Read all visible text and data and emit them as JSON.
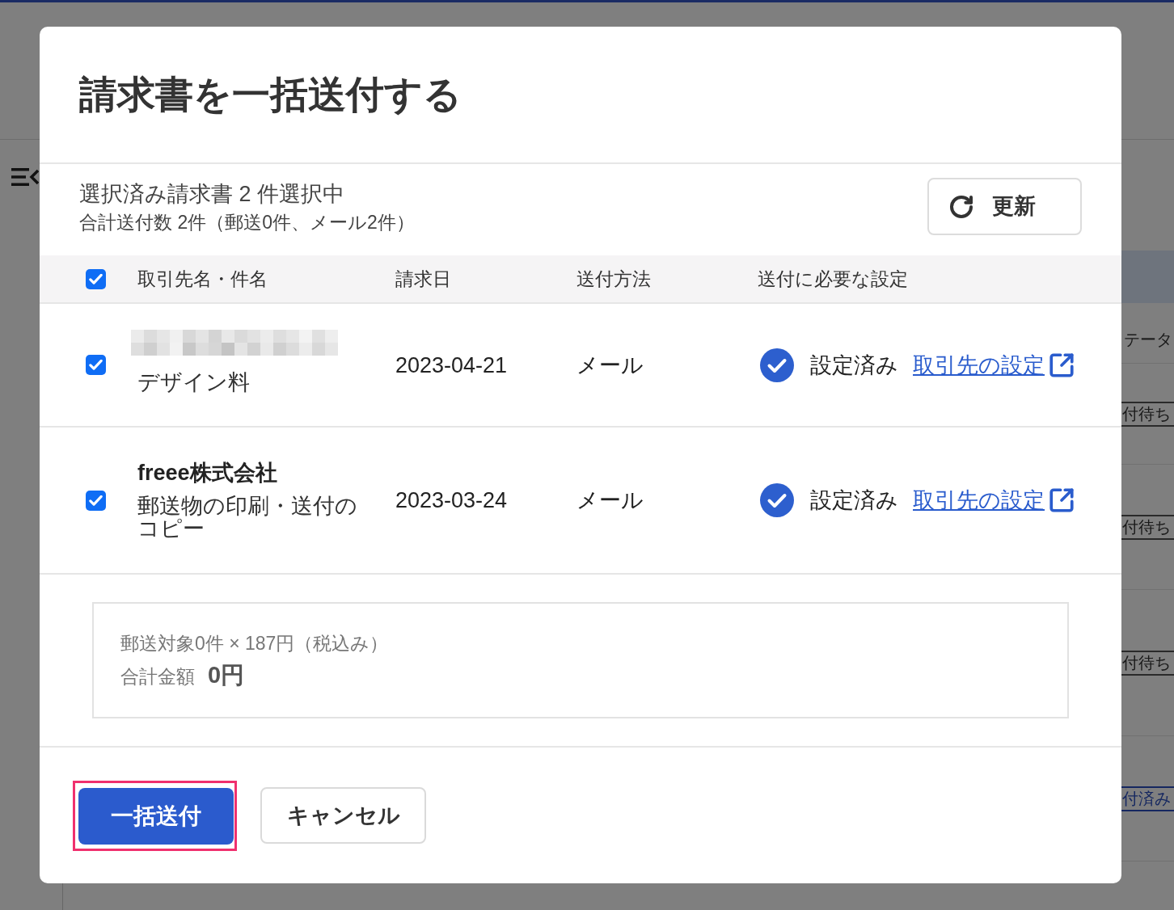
{
  "background_page": {
    "column_header": "テータ",
    "status_badges": [
      {
        "label": "付待ち",
        "kind": "pending"
      },
      {
        "label": "付待ち",
        "kind": "pending"
      },
      {
        "label": "付待ち",
        "kind": "pending"
      },
      {
        "label": "付済み",
        "kind": "done"
      }
    ]
  },
  "dialog": {
    "title": "請求書を一括送付する",
    "selection_summary": "選択済み請求書 2 件選択中",
    "send_count": "合計送付数 2件（郵送0件、メール2件）",
    "refresh_button": "更新",
    "table": {
      "select_all_checked": true,
      "columns": [
        "取引先名・件名",
        "請求日",
        "送付方法",
        "送付に必要な設定"
      ],
      "rows": [
        {
          "checked": true,
          "client_redacted": true,
          "subject": "デザイン料",
          "date": "2023-04-21",
          "method": "メール",
          "setting_status": "設定済み",
          "link": "取引先の設定"
        },
        {
          "checked": true,
          "client_redacted": false,
          "client": "freee株式会社",
          "subject": "郵送物の印刷・送付のコピー",
          "date": "2023-03-24",
          "method": "メール",
          "setting_status": "設定済み",
          "link": "取引先の設定"
        }
      ]
    },
    "summary": {
      "postage_line": "郵送対象0件 × 187円（税込み）",
      "total_label": "合計金額",
      "total_value": "0円"
    },
    "buttons": [
      {
        "label": "一括送付",
        "kind": "primary",
        "highlighted": true
      },
      {
        "label": "キャンセル",
        "kind": "secondary",
        "highlighted": false
      }
    ]
  }
}
